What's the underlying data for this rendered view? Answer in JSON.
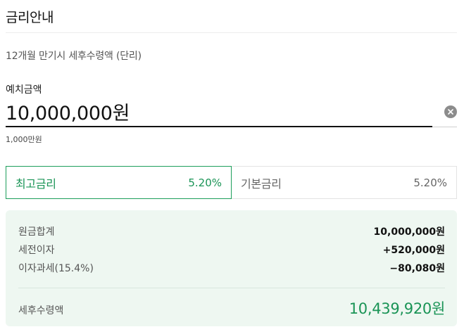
{
  "header": {
    "title": "금리안내",
    "subtitle": "12개월 만기시 세후수령액 (단리)"
  },
  "deposit": {
    "label": "예치금액",
    "value": "10,000,000원",
    "hint": "1,000만원",
    "clear_icon": "close-circle-icon"
  },
  "rate_tabs": [
    {
      "label": "최고금리",
      "rate": "5.20%",
      "selected": true
    },
    {
      "label": "기본금리",
      "rate": "5.20%",
      "selected": false
    }
  ],
  "summary": {
    "rows": [
      {
        "label": "원금합계",
        "value": "10,000,000원"
      },
      {
        "label": "세전이자",
        "value": "+520,000원"
      },
      {
        "label": "이자과세(15.4%)",
        "value": "−80,080원"
      }
    ],
    "total_label": "세후수령액",
    "total_value": "10,439,920원"
  },
  "colors": {
    "accent": "#1a9456",
    "panel_bg": "#eef7f1"
  }
}
